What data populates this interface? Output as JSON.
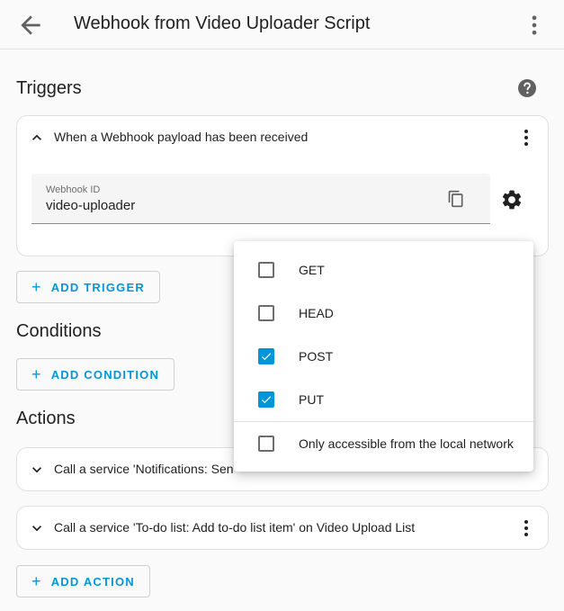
{
  "header": {
    "title": "Webhook from Video Uploader Script"
  },
  "triggers": {
    "title": "Triggers",
    "card_title": "When a Webhook payload has been received",
    "webhook_field": {
      "label": "Webhook ID",
      "value": "video-uploader"
    },
    "add_label": "ADD TRIGGER"
  },
  "conditions": {
    "title": "Conditions",
    "add_label": "ADD CONDITION"
  },
  "actions": {
    "title": "Actions",
    "items": [
      {
        "label": "Call a service 'Notifications: Sen"
      },
      {
        "label": "Call a service 'To-do list: Add to-do list item' on Video Upload List"
      }
    ],
    "add_label": "ADD ACTION"
  },
  "methods_menu": {
    "items": [
      {
        "label": "GET",
        "checked": false
      },
      {
        "label": "HEAD",
        "checked": false
      },
      {
        "label": "POST",
        "checked": true
      },
      {
        "label": "PUT",
        "checked": true
      }
    ],
    "local_only": {
      "label": "Only accessible from the local network",
      "checked": false
    }
  },
  "colors": {
    "accent": "#0395d9",
    "icon": "#616161",
    "text": "#212121"
  },
  "icons": [
    "arrow-left-icon",
    "dots-vertical-icon",
    "help-circle-icon",
    "chevron-up-icon",
    "chevron-down-icon",
    "content-copy-icon",
    "gear-icon",
    "plus-icon",
    "checkbox-icon"
  ]
}
